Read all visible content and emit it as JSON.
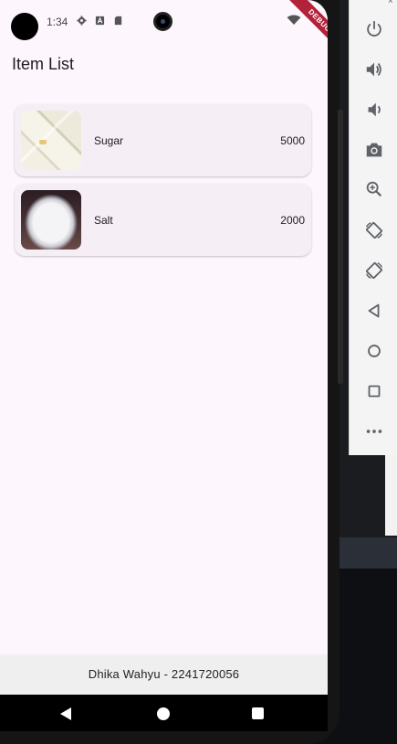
{
  "status_bar": {
    "time": "1:34",
    "icons": [
      "gear-icon",
      "a-icon",
      "sd-card-icon",
      "wifi-icon"
    ],
    "debug_banner": "DEBUG"
  },
  "app_bar": {
    "title": "Item List"
  },
  "items": [
    {
      "name": "Sugar",
      "value": "5000",
      "image": "sugar-cubes-image"
    },
    {
      "name": "Salt",
      "value": "2000",
      "image": "salt-pile-image"
    }
  ],
  "footer": {
    "text": "Dhika Wahyu - 2241720056"
  },
  "nav_bar": {
    "buttons": [
      "back",
      "home",
      "recents"
    ]
  },
  "emulator_toolbar": {
    "close": "×",
    "buttons": [
      "power-icon",
      "volume-up-icon",
      "volume-down-icon",
      "camera-icon",
      "zoom-icon",
      "rotate-left-icon",
      "rotate-right-icon",
      "back-icon",
      "home-icon",
      "overview-icon",
      "more-icon"
    ]
  },
  "colors": {
    "screen_bg": "#fdf6fd",
    "card_bg": "#f5eff5",
    "footer_bg": "#efefef",
    "debug_banner": "#b2233a",
    "navbar": "#000000"
  }
}
